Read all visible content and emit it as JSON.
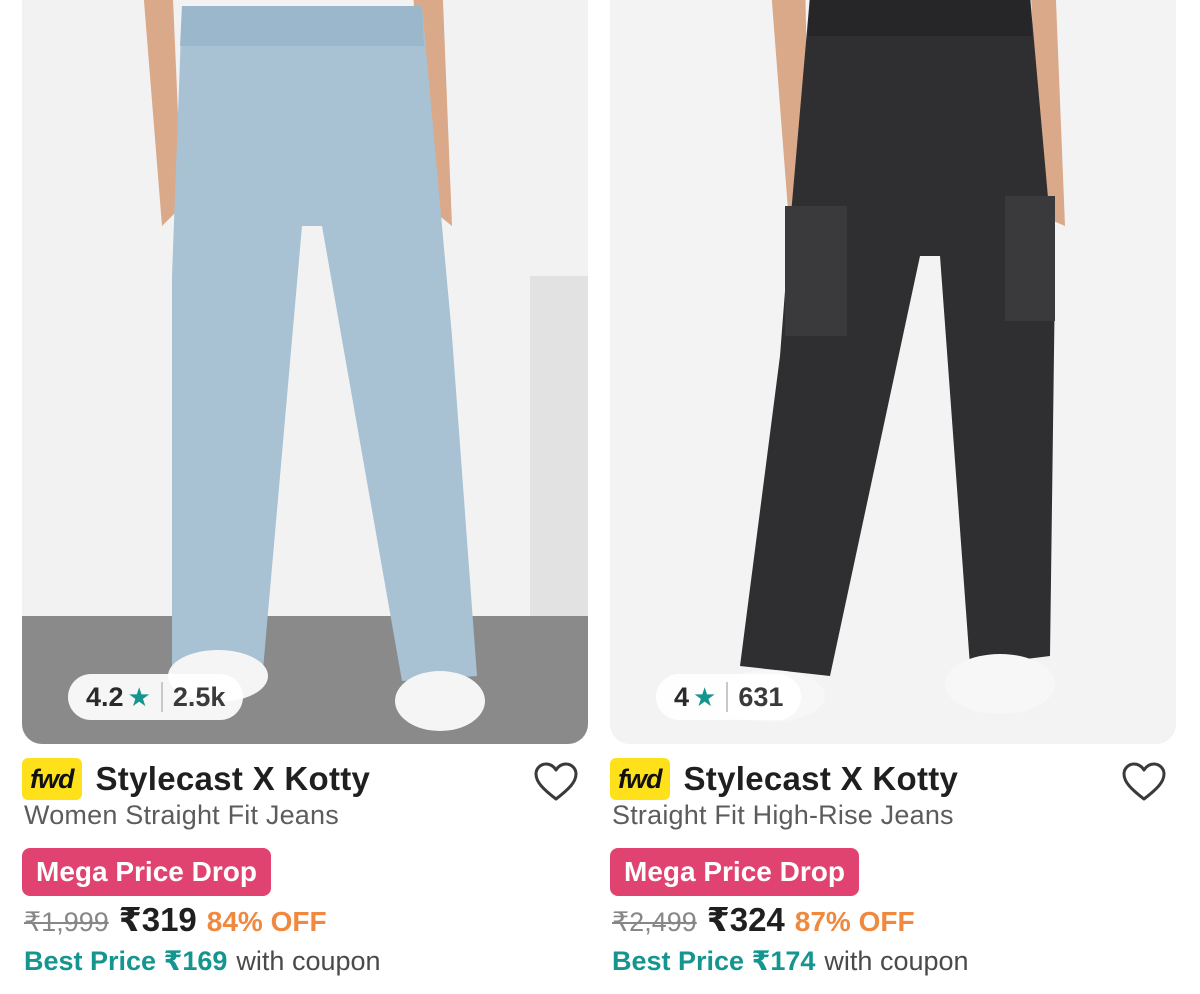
{
  "products": [
    {
      "rating": "4.2",
      "review_count": "2.5k",
      "badge": "fwd",
      "brand": "Stylecast X Kotty",
      "name": "Women Straight Fit Jeans",
      "deal_tag": "Mega Price Drop",
      "mrp": "₹1,999",
      "price": "₹319",
      "discount": "84% OFF",
      "best_price_label": "Best Price ₹169",
      "best_price_suffix": "with coupon",
      "image_desc": "light-blue-wide-leg-jeans"
    },
    {
      "rating": "4",
      "review_count": "631",
      "badge": "fwd",
      "brand": "Stylecast X Kotty",
      "name": "Straight Fit High-Rise Jeans",
      "deal_tag": "Mega Price Drop",
      "mrp": "₹2,499",
      "price": "₹324",
      "discount": "87% OFF",
      "best_price_label": "Best Price ₹174",
      "best_price_suffix": "with coupon",
      "image_desc": "black-cargo-jeans"
    }
  ],
  "colors": {
    "accent_teal": "#14958f",
    "deal_pink": "#e14371",
    "discount_orange": "#f0883e",
    "fwd_yellow": "#ffe11b"
  },
  "icons": {
    "rating": "star-icon",
    "wishlist": "heart-outline-icon"
  }
}
